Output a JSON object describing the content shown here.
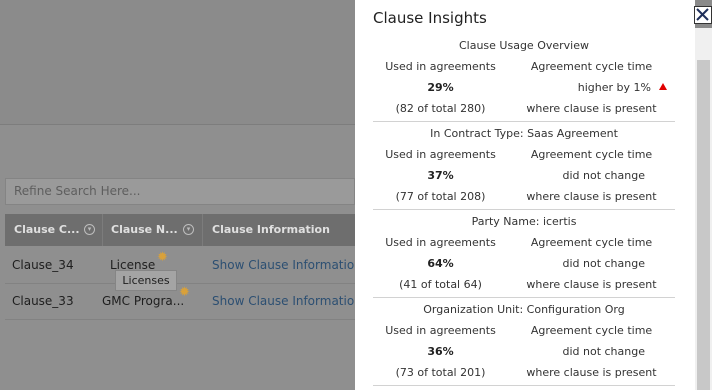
{
  "background": {
    "search_placeholder": "Refine Search Here...",
    "columns": [
      "Clause C...",
      "Clause N...",
      "Clause Information"
    ],
    "rows": [
      {
        "code": "Clause_34",
        "name": "License",
        "info": "Show Clause Information"
      },
      {
        "code": "Clause_33",
        "name": "GMC Progra...",
        "info": "Show Clause Information"
      }
    ],
    "tooltip": "Licenses"
  },
  "panel": {
    "title": "Clause Insights",
    "sections": [
      {
        "title": "Clause Usage Overview",
        "left_label": "Used in agreements",
        "right_label": "Agreement cycle time",
        "percent": "29%",
        "cycle": "higher by 1%",
        "count": "(82 of total 280)",
        "note": "where clause is present"
      },
      {
        "title": "In Contract Type: Saas Agreement",
        "left_label": "Used in agreements",
        "right_label": "Agreement cycle time",
        "percent": "37%",
        "cycle": "did not change",
        "count": "(77 of total 208)",
        "note": "where clause is present"
      },
      {
        "title": "Party Name: icertis",
        "left_label": "Used in agreements",
        "right_label": "Agreement cycle time",
        "percent": "64%",
        "cycle": "did not change",
        "count": "(41 of total 64)",
        "note": "where clause is present"
      },
      {
        "title": "Organization Unit: Configuration Org",
        "left_label": "Used in agreements",
        "right_label": "Agreement cycle time",
        "percent": "36%",
        "cycle": "did not change",
        "count": "(73 of total 201)",
        "note": "where clause is present"
      }
    ],
    "close_icon": "close-x-icon",
    "trend_up_color": "#e00000"
  }
}
